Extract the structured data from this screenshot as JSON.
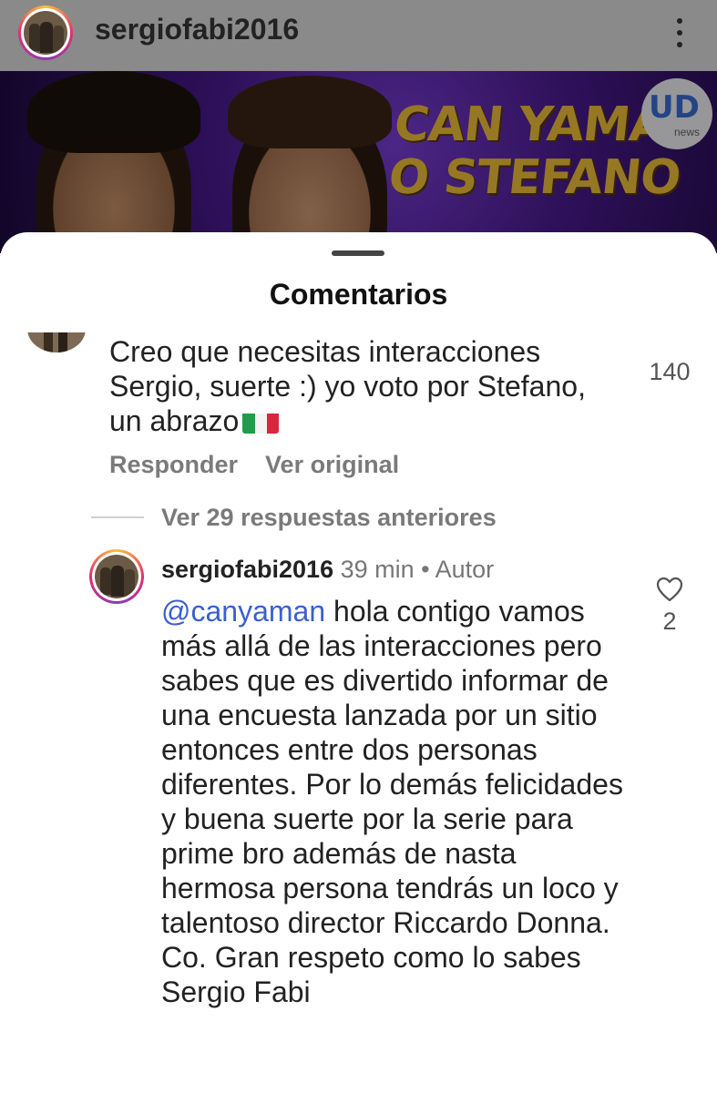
{
  "header": {
    "username": "sergiofabi2016",
    "menu_icon": "more-vertical-icon"
  },
  "banner": {
    "title_line1": "CAN YAMAN",
    "title_line2": "O STEFANO",
    "logo_text": "UD",
    "logo_sub": "news"
  },
  "sheet": {
    "title": "Comentarios"
  },
  "comment": {
    "text": "Creo que necesitas interacciones Sergio, suerte :) yo voto por Stefano, un abrazo",
    "likes": "140",
    "reply_label": "Responder",
    "original_label": "Ver original"
  },
  "replies_toggle": "Ver 29 respuestas anteriores",
  "reply": {
    "username": "sergiofabi2016",
    "time": "39 min",
    "separator": "•",
    "role": "Autor",
    "mention": "@canyaman",
    "text": "hola contigo vamos más allá de las interacciones pero sabes que es divertido informar de una encuesta lanzada por un sitio entonces entre dos personas diferentes. Por lo demás felicidades y buena suerte por la serie para prime bro además de nasta hermosa persona tendrás un loco y talentoso director Riccardo Donna. Co. Gran respeto como lo sabes Sergio Fabi",
    "likes": "2"
  },
  "colors": {
    "mention": "#3b5fd0",
    "like_active": "#e0244f",
    "banner_title": "#f2c23a"
  }
}
